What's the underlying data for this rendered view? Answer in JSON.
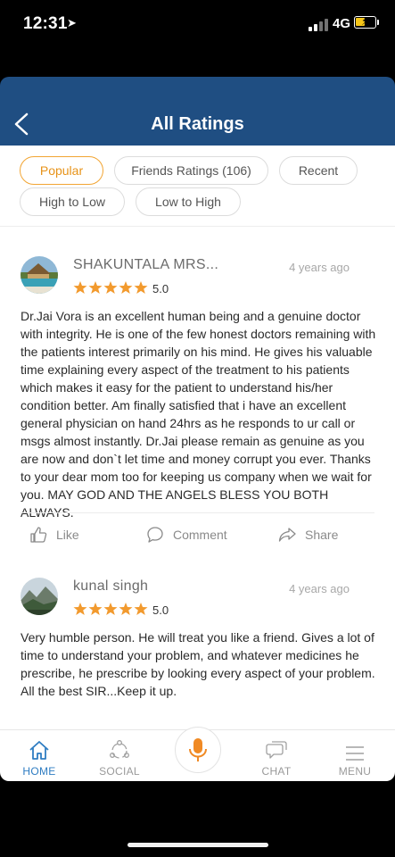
{
  "status_bar": {
    "time": "12:31",
    "network": "4G"
  },
  "header": {
    "title": "All Ratings"
  },
  "filters": [
    {
      "label": "Popular",
      "active": true
    },
    {
      "label": "Friends Ratings (106)",
      "active": false
    },
    {
      "label": "Recent",
      "active": false
    },
    {
      "label": "High to Low",
      "active": false
    },
    {
      "label": "Low to High",
      "active": false
    }
  ],
  "reviews": [
    {
      "name": "SHAKUNTALA MRS...",
      "time": "4 years ago",
      "stars": 5,
      "rating": "5.0",
      "text": "Dr.Jai Vora is an excellent human being and a genuine doctor with integrity. He is one of the few honest doctors remaining with the patients interest primarily on his mind. He gives his valuable time explaining every aspect of the treatment to his patients which makes it easy for the patient to understand his/her condition better. Am finally satisfied that i have an excellent general physician on hand 24hrs as he responds to ur call or msgs almost instantly. Dr.Jai please remain as genuine as you are now and don`t let time and money corrupt you ever. Thanks to your dear mom too for keeping us company when we wait for you. MAY GOD AND THE ANGELS BLESS YOU BOTH ALWAYS."
    },
    {
      "name": "kunal singh",
      "time": "4 years ago",
      "stars": 5,
      "rating": "5.0",
      "text": "Very humble person. He will treat you like a friend. Gives a lot of time to understand your problem, and whatever medicines he prescribe, he prescribe by looking every aspect of your problem. All the best SIR...Keep it up."
    }
  ],
  "actions": {
    "like": "Like",
    "comment": "Comment",
    "share": "Share"
  },
  "nav": {
    "home": "HOME",
    "social": "SOCIAL",
    "chat": "CHAT",
    "menu": "MENU"
  },
  "colors": {
    "header": "#1f4e82",
    "accent": "#f2a533",
    "star": "#f29a2e",
    "nav_active": "#2f7dc2"
  }
}
